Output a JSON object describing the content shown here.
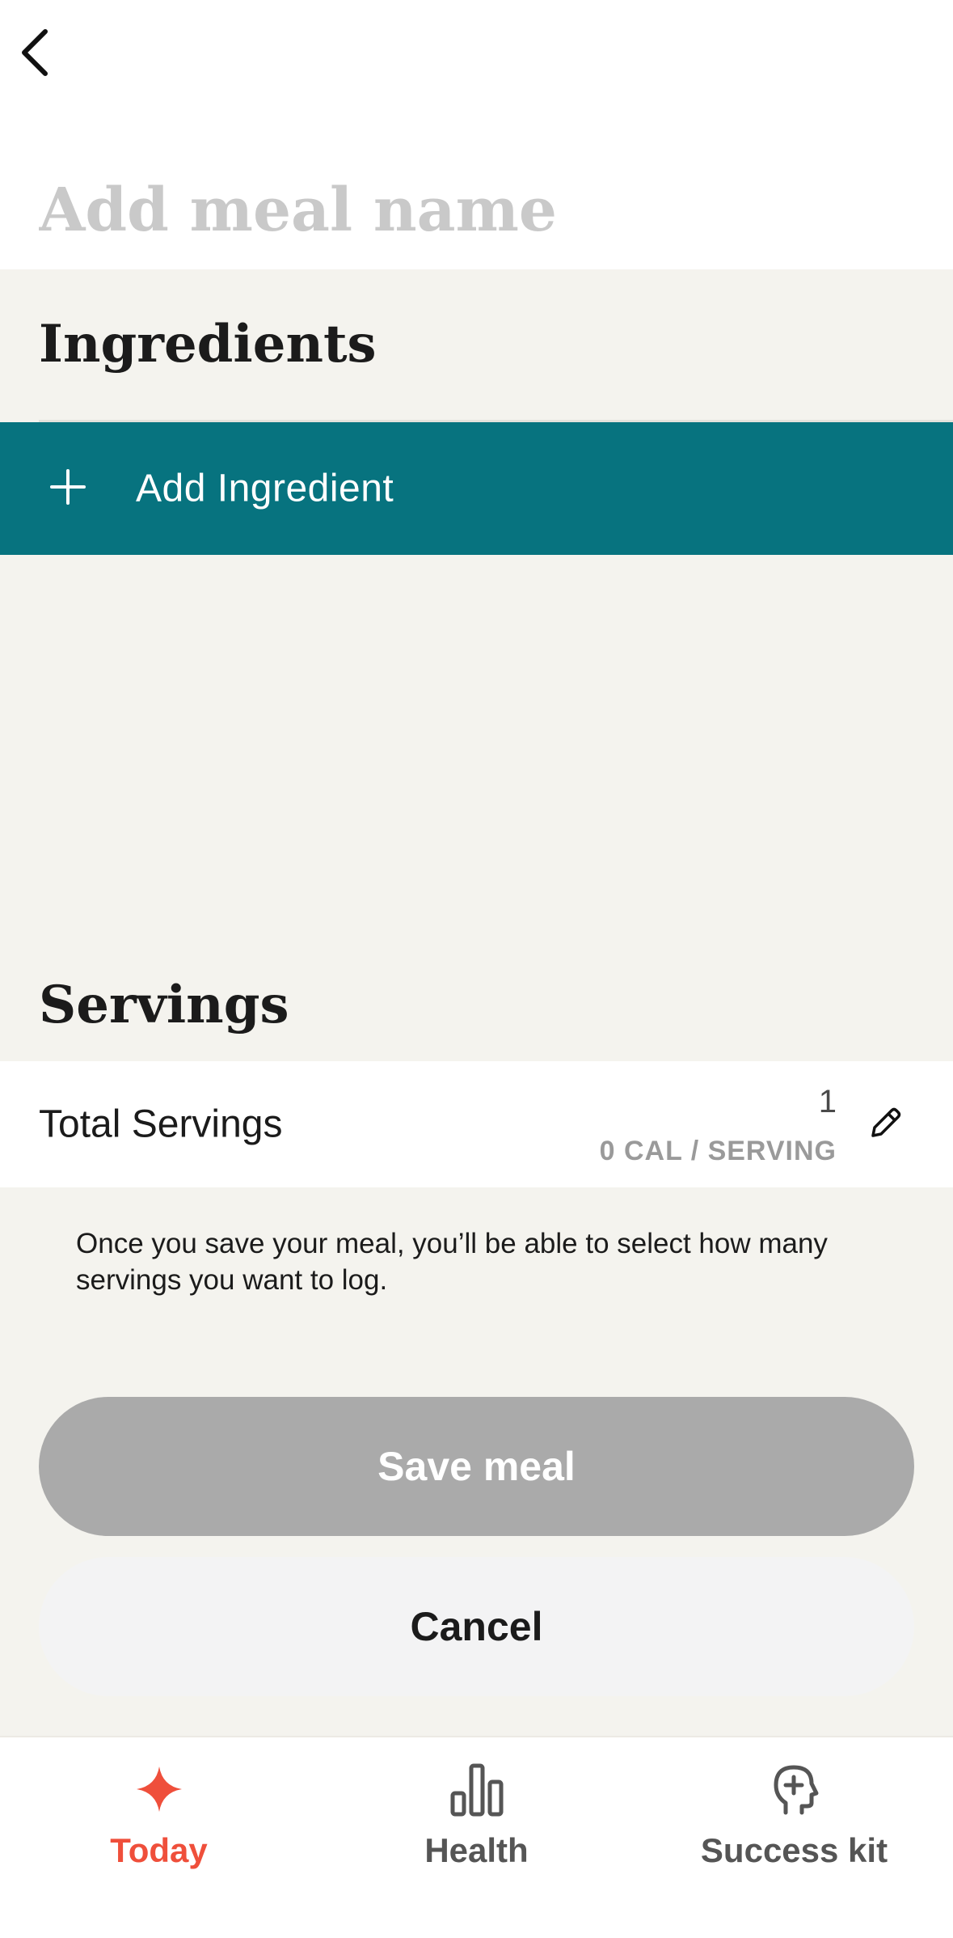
{
  "header": {
    "back_icon": "chevron-left-icon",
    "meal_name_placeholder": "Add meal name"
  },
  "ingredients": {
    "heading": "Ingredients",
    "add_label": "Add Ingredient",
    "add_icon": "plus-icon"
  },
  "servings": {
    "heading": "Servings",
    "row_label": "Total Servings",
    "count": "1",
    "calories": "0 CAL / SERVING",
    "edit_icon": "pencil-icon",
    "note": "Once you save your meal, you’ll be able to select how many servings you want to log."
  },
  "actions": {
    "save_label": "Save meal",
    "cancel_label": "Cancel"
  },
  "tabbar": {
    "today": {
      "label": "Today",
      "icon": "sparkle-icon",
      "active": true
    },
    "health": {
      "label": "Health",
      "icon": "bar-chart-icon"
    },
    "success": {
      "label": "Success kit",
      "icon": "head-plus-icon"
    }
  },
  "colors": {
    "accent_teal": "#07737f",
    "active_tab": "#ef4f3b",
    "disabled_button": "#aaaaaa",
    "background": "#f4f3ee"
  }
}
